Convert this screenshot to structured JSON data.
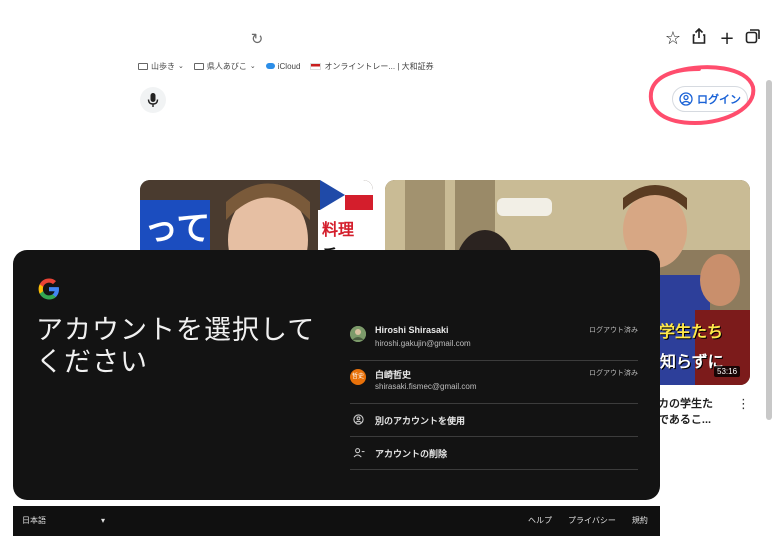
{
  "browser": {
    "reload_glyph": "↻",
    "toolbar_icons": [
      "star-icon",
      "share-icon",
      "plus-icon",
      "tabs-icon"
    ],
    "bookmarks": [
      {
        "icon": "folder-icon",
        "label": "山歩き",
        "dropdown": true
      },
      {
        "icon": "folder-icon",
        "label": "県人あびこ",
        "dropdown": true
      },
      {
        "icon": "cloud-icon",
        "label": "iCloud",
        "dropdown": false
      },
      {
        "icon": "flag-icon",
        "label": "オンライントレー... | 大和証券",
        "dropdown": false
      }
    ]
  },
  "header": {
    "login_label": "ログイン",
    "accent_color": "#1a62d6",
    "annotation_color": "#ff4d6d"
  },
  "video": {
    "duration": "53:16",
    "title_fragment": "カの学生た\nであるこ...",
    "caption_line1": "学生たち",
    "caption_line2": "知らずに"
  },
  "dialog": {
    "title": "アカウントを選択してください",
    "accounts": [
      {
        "name": "Hiroshi Shirasaki",
        "email": "hiroshi.gakujin@gmail.com",
        "status": "ログアウト済み",
        "avatar_color": "#6f8f5f"
      },
      {
        "name": "白崎哲史",
        "email": "shirasaki.fismec@gmail.com",
        "status": "ログアウト済み",
        "avatar_color": "#e8710a"
      }
    ],
    "use_other_label": "別のアカウントを使用",
    "remove_label": "アカウントの削除"
  },
  "footer": {
    "language": "日本語",
    "links": [
      "ヘルプ",
      "プライバシー",
      "規約"
    ]
  }
}
